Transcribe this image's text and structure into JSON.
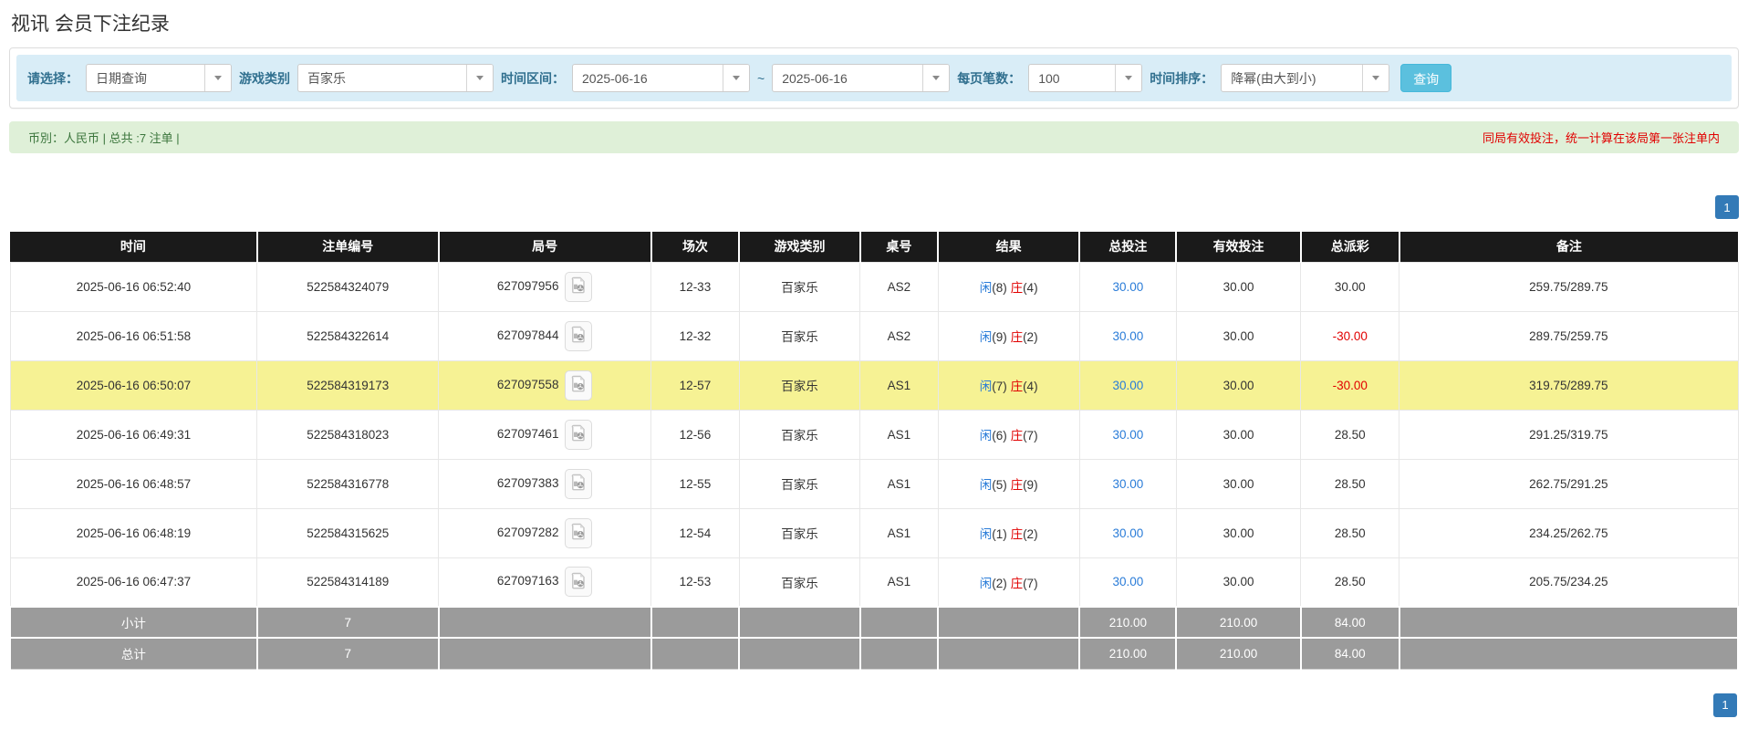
{
  "page": {
    "title": "视讯 会员下注纪录"
  },
  "filters": {
    "select_label": "请选择：",
    "select_value": "日期查询",
    "game_type_label": "游戏类别",
    "game_type_value": "百家乐",
    "time_range_label": "时间区间：",
    "date_from": "2025-06-16",
    "date_separator": "~",
    "date_to": "2025-06-16",
    "page_size_label": "每页笔数：",
    "page_size_value": "100",
    "sort_label": "时间排序：",
    "sort_value": "降幂(由大到小)",
    "search_button": "查询"
  },
  "summary": {
    "left_text": "币別：人民币 | 总共 :7 注单 |",
    "right_notice": "同局有效投注，统一计算在该局第一张注单内"
  },
  "pagination": {
    "page": "1"
  },
  "table": {
    "headers": [
      "时间",
      "注单编号",
      "局号",
      "场次",
      "游戏类别",
      "桌号",
      "结果",
      "总投注",
      "有效投注",
      "总派彩",
      "备注"
    ],
    "rows": [
      {
        "time": "2025-06-16 06:52:40",
        "bet_id": "522584324079",
        "round_id": "627097956",
        "session": "12-33",
        "game": "百家乐",
        "table_no": "AS2",
        "r_p": "闲",
        "r_pn": "(8)",
        "r_b": "庄",
        "r_bn": "(4)",
        "total_bet": "30.00",
        "valid_bet": "30.00",
        "payout": "30.00",
        "note": "259.75/289.75",
        "highlighted": false
      },
      {
        "time": "2025-06-16 06:51:58",
        "bet_id": "522584322614",
        "round_id": "627097844",
        "session": "12-32",
        "game": "百家乐",
        "table_no": "AS2",
        "r_p": "闲",
        "r_pn": "(9)",
        "r_b": "庄",
        "r_bn": "(2)",
        "total_bet": "30.00",
        "valid_bet": "30.00",
        "payout": "-30.00",
        "note": "289.75/259.75",
        "highlighted": false
      },
      {
        "time": "2025-06-16 06:50:07",
        "bet_id": "522584319173",
        "round_id": "627097558",
        "session": "12-57",
        "game": "百家乐",
        "table_no": "AS1",
        "r_p": "闲",
        "r_pn": "(7)",
        "r_b": "庄",
        "r_bn": "(4)",
        "total_bet": "30.00",
        "valid_bet": "30.00",
        "payout": "-30.00",
        "note": "319.75/289.75",
        "highlighted": true
      },
      {
        "time": "2025-06-16 06:49:31",
        "bet_id": "522584318023",
        "round_id": "627097461",
        "session": "12-56",
        "game": "百家乐",
        "table_no": "AS1",
        "r_p": "闲",
        "r_pn": "(6)",
        "r_b": "庄",
        "r_bn": "(7)",
        "total_bet": "30.00",
        "valid_bet": "30.00",
        "payout": "28.50",
        "note": "291.25/319.75",
        "highlighted": false
      },
      {
        "time": "2025-06-16 06:48:57",
        "bet_id": "522584316778",
        "round_id": "627097383",
        "session": "12-55",
        "game": "百家乐",
        "table_no": "AS1",
        "r_p": "闲",
        "r_pn": "(5)",
        "r_b": "庄",
        "r_bn": "(9)",
        "total_bet": "30.00",
        "valid_bet": "30.00",
        "payout": "28.50",
        "note": "262.75/291.25",
        "highlighted": false
      },
      {
        "time": "2025-06-16 06:48:19",
        "bet_id": "522584315625",
        "round_id": "627097282",
        "session": "12-54",
        "game": "百家乐",
        "table_no": "AS1",
        "r_p": "闲",
        "r_pn": "(1)",
        "r_b": "庄",
        "r_bn": "(2)",
        "total_bet": "30.00",
        "valid_bet": "30.00",
        "payout": "28.50",
        "note": "234.25/262.75",
        "highlighted": false
      },
      {
        "time": "2025-06-16 06:47:37",
        "bet_id": "522584314189",
        "round_id": "627097163",
        "session": "12-53",
        "game": "百家乐",
        "table_no": "AS1",
        "r_p": "闲",
        "r_pn": "(2)",
        "r_b": "庄",
        "r_bn": "(7)",
        "total_bet": "30.00",
        "valid_bet": "30.00",
        "payout": "28.50",
        "note": "205.75/234.25",
        "highlighted": false
      }
    ],
    "subtotal": {
      "label": "小计",
      "count": "7",
      "total_bet": "210.00",
      "valid_bet": "210.00",
      "payout": "84.00"
    },
    "total": {
      "label": "总计",
      "count": "7",
      "total_bet": "210.00",
      "valid_bet": "210.00",
      "payout": "84.00"
    }
  }
}
